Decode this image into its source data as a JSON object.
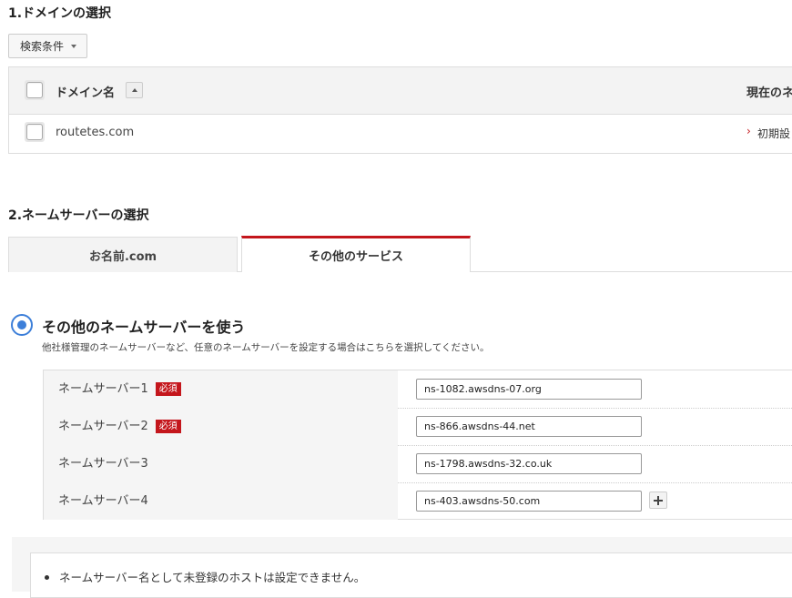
{
  "section1": {
    "title": "1.ドメインの選択",
    "search_button": "検索条件",
    "table": {
      "col_domain": "ドメイン名",
      "col_current": "現在のネ",
      "rows": [
        {
          "domain": "routetes.com",
          "current_prefix": "›",
          "current": "初期設"
        }
      ]
    }
  },
  "section2": {
    "title": "2.ネームサーバーの選択",
    "tabs": [
      "お名前.com",
      "その他のサービス"
    ],
    "option": {
      "title": "その他のネームサーバーを使う",
      "description": "他社様管理のネームサーバーなど、任意のネームサーバーを設定する場合はこちらを選択してください。"
    },
    "nameservers": [
      {
        "label": "ネームサーバー1",
        "required": "必須",
        "value": "ns-1082.awsdns-07.org"
      },
      {
        "label": "ネームサーバー2",
        "required": "必須",
        "value": "ns-866.awsdns-44.net"
      },
      {
        "label": "ネームサーバー3",
        "required": "",
        "value": "ns-1798.awsdns-32.co.uk"
      },
      {
        "label": "ネームサーバー4",
        "required": "",
        "value": "ns-403.awsdns-50.com"
      }
    ],
    "note": "ネームサーバー名として未登録のホストは設定できません。"
  },
  "colors": {
    "accent": "#c4161c",
    "radio": "#3d7fd9"
  }
}
